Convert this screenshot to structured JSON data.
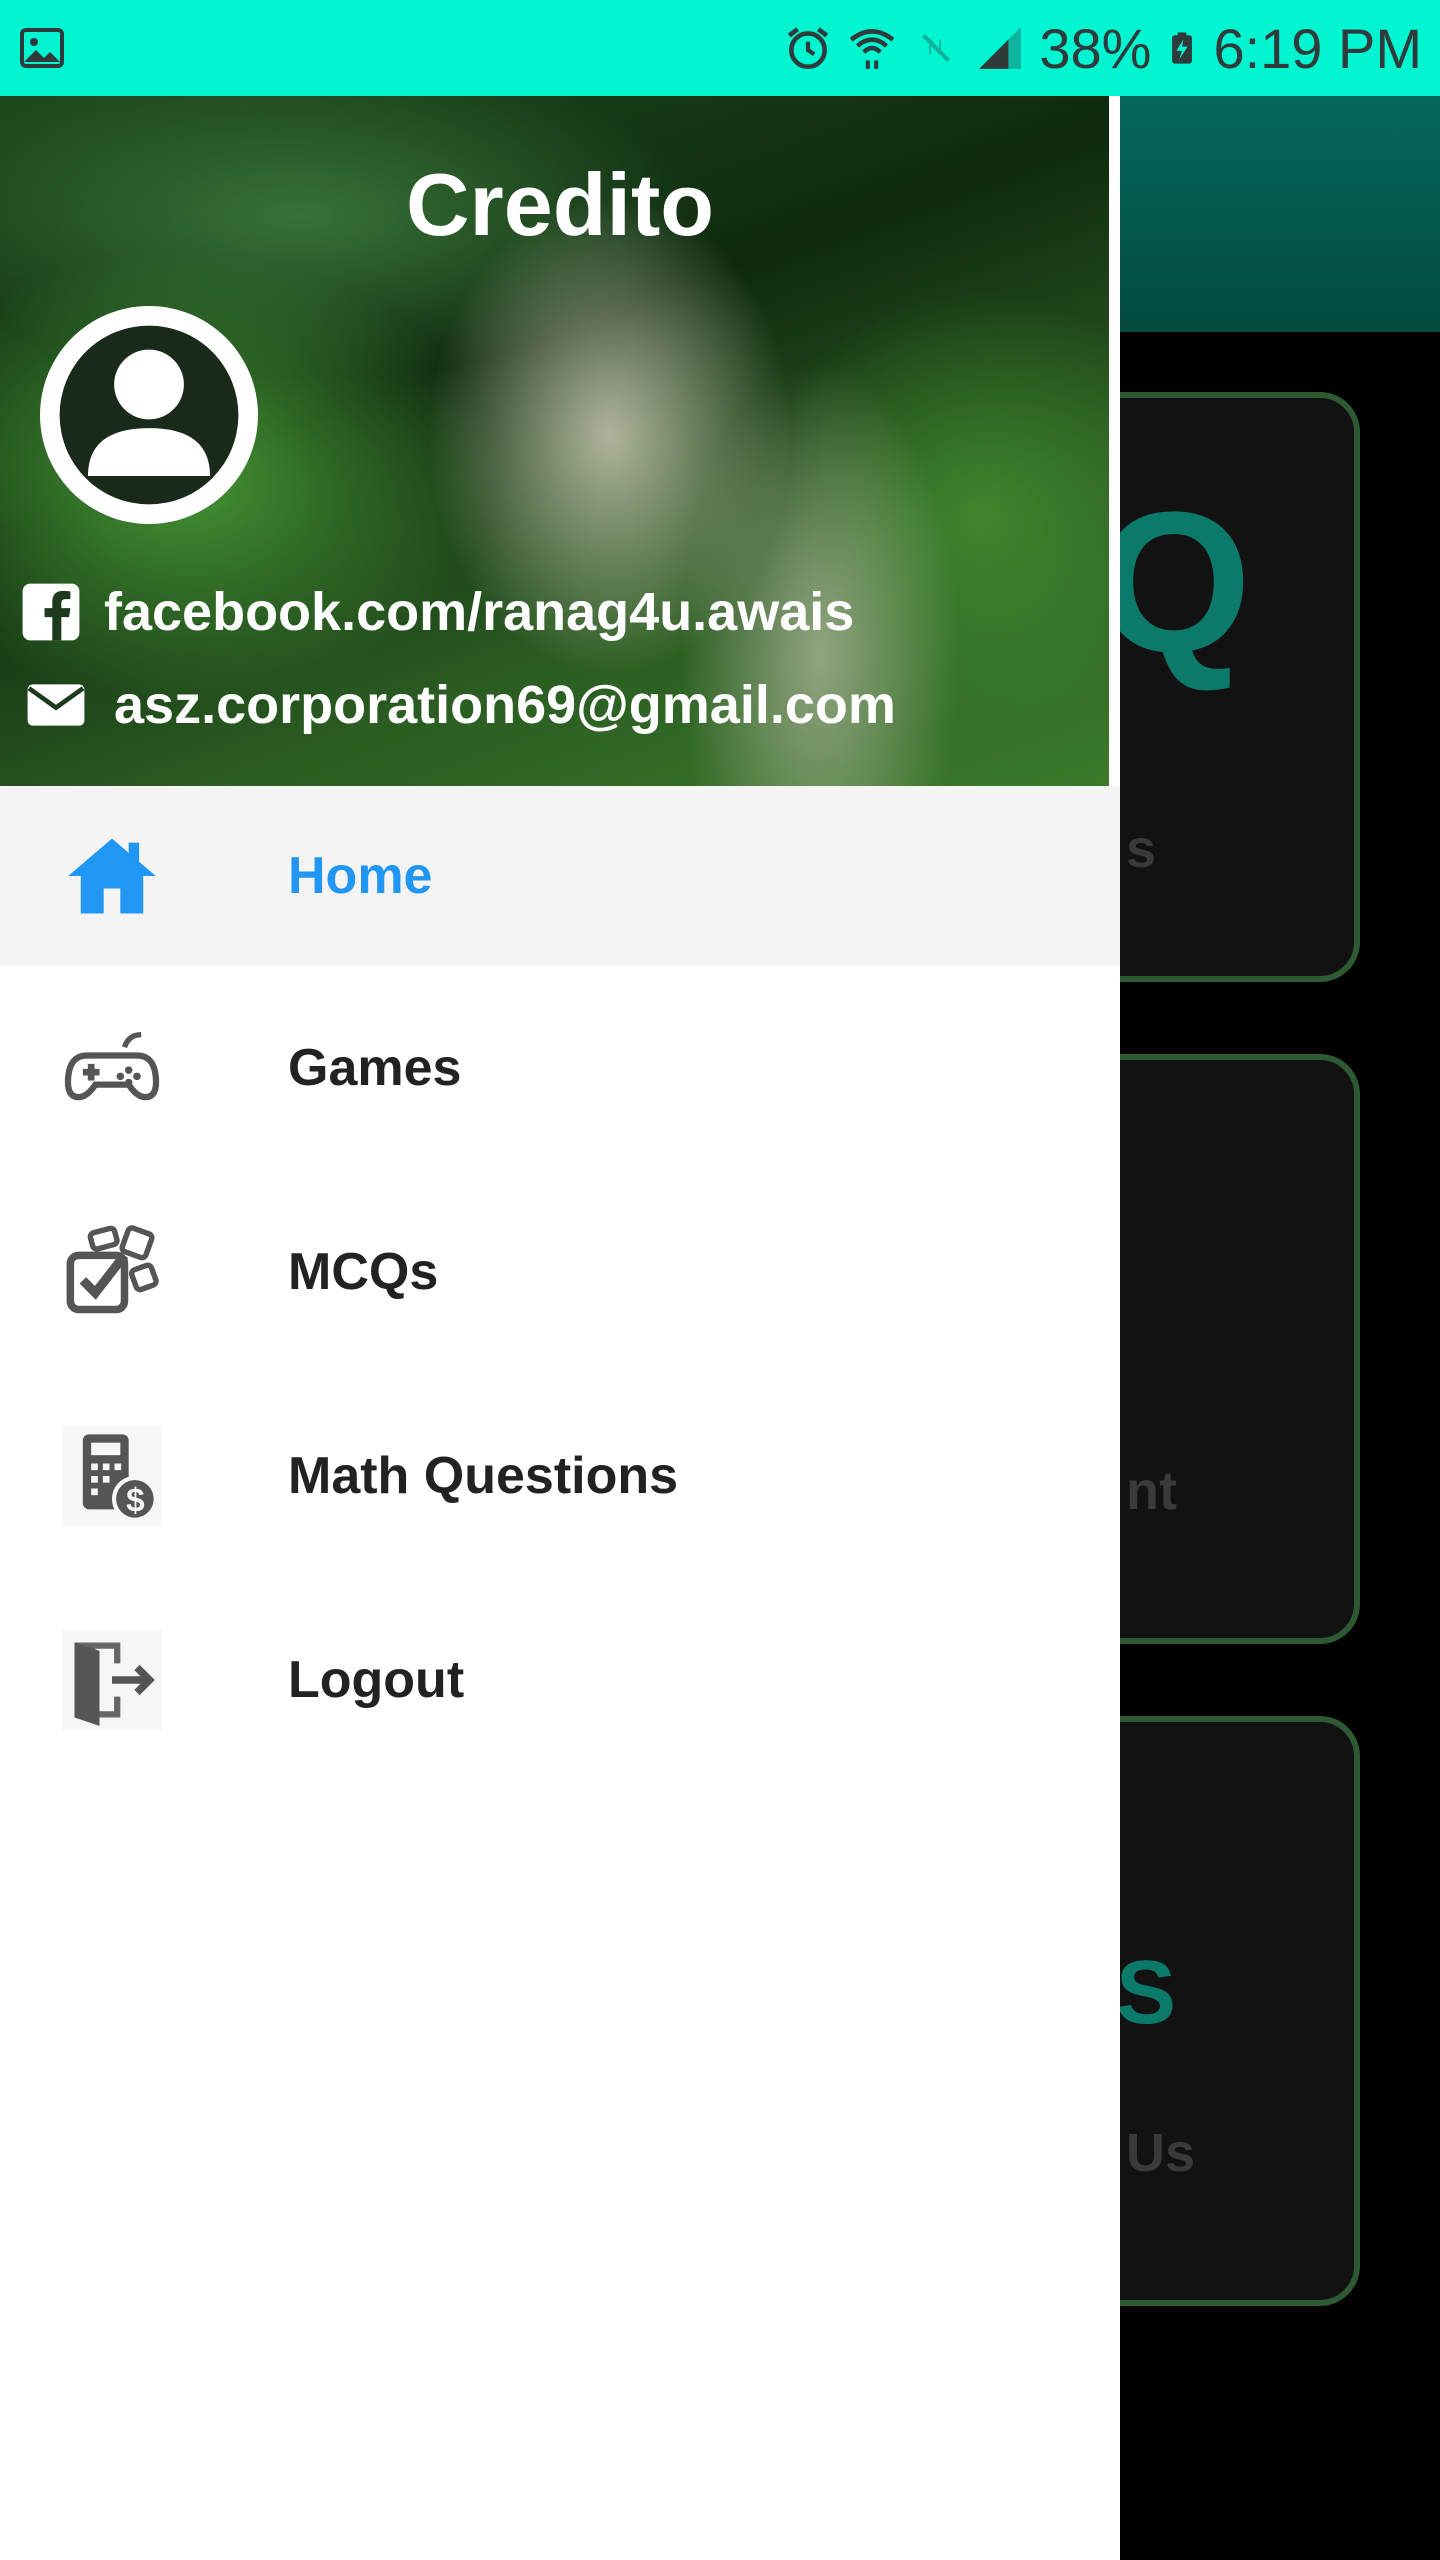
{
  "status_bar": {
    "battery": "38%",
    "time": "6:19 PM",
    "icons": [
      "image-icon",
      "alarm-icon",
      "wifi-icon",
      "no-signal-icon",
      "signal-icon",
      "battery-charging-icon"
    ]
  },
  "background_app": {
    "cards": [
      {
        "label": "s"
      },
      {
        "label": "nt"
      },
      {
        "label": "Us"
      }
    ],
    "accent": "#0b7a6a"
  },
  "drawer": {
    "title": "Credito",
    "facebook": "facebook.com/ranag4u.awais",
    "email": "asz.corporation69@gmail.com",
    "menu": [
      {
        "label": "Home",
        "icon": "home-icon",
        "active": true
      },
      {
        "label": "Games",
        "icon": "gamepad-icon",
        "active": false
      },
      {
        "label": "MCQs",
        "icon": "checklist-icon",
        "active": false
      },
      {
        "label": "Math Questions",
        "icon": "calculator-icon",
        "active": false
      },
      {
        "label": "Logout",
        "icon": "logout-icon",
        "active": false
      }
    ]
  },
  "colors": {
    "status_bar": "#00f5d0",
    "active": "#2196f3",
    "text": "#222222"
  }
}
